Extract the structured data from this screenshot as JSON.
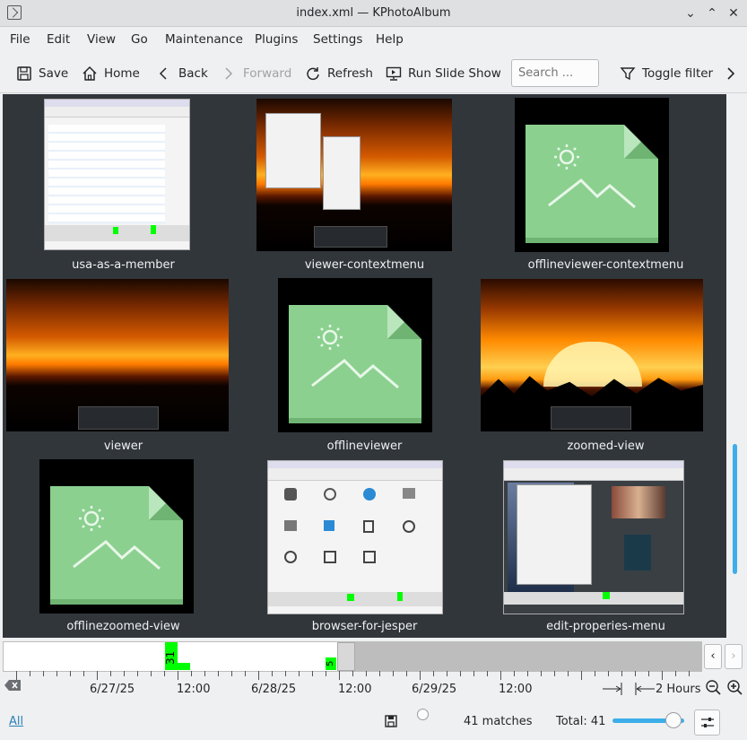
{
  "window": {
    "title": "index.xml — KPhotoAlbum"
  },
  "menu": [
    "File",
    "Edit",
    "View",
    "Go",
    "Maintenance",
    "Plugins",
    "Settings",
    "Help"
  ],
  "toolbar": {
    "save": "Save",
    "home": "Home",
    "back": "Back",
    "forward": "Forward",
    "refresh": "Refresh",
    "slideshow": "Run Slide Show",
    "search_placeholder": "Search ...",
    "toggle_filter": "Toggle filter"
  },
  "thumbnails": [
    {
      "caption": "usa-as-a-member",
      "kind": "screenshot-browser"
    },
    {
      "caption": "viewer-contextmenu",
      "kind": "sunset-menu"
    },
    {
      "caption": "offlineviewer-contextmenu",
      "kind": "offline-file"
    },
    {
      "caption": "viewer",
      "kind": "sunset"
    },
    {
      "caption": "offlineviewer",
      "kind": "offline-file"
    },
    {
      "caption": "zoomed-view",
      "kind": "sunset-zoom"
    },
    {
      "caption": "offlinezoomed-view",
      "kind": "offline-file"
    },
    {
      "caption": "browser-for-jesper",
      "kind": "screenshot-icons"
    },
    {
      "caption": "edit-properies-menu",
      "kind": "screenshot-menu"
    }
  ],
  "timeline": {
    "bar_labels": [
      "31",
      "5"
    ],
    "labels": [
      "6/27/25",
      "12:00",
      "6/28/25",
      "12:00",
      "6/29/25",
      "12:00"
    ],
    "zoom_label": "2 Hours"
  },
  "status": {
    "all_link": "All",
    "matches": "41 matches",
    "total": "Total: 41",
    "zoom_fraction": 0.85
  },
  "colors": {
    "accent": "#3daee9",
    "thumb_area": "#31363b",
    "bar": "#00ff00",
    "offline_file": "#8bd08f"
  }
}
